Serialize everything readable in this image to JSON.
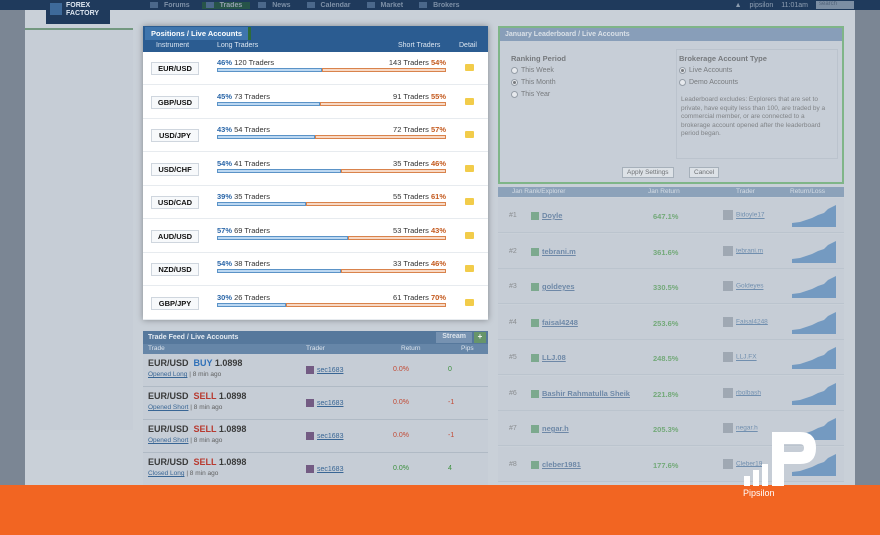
{
  "nav": {
    "items": [
      "Forums",
      "Trades",
      "News",
      "Calendar",
      "Market",
      "Brokers"
    ],
    "active": "Trades",
    "logo_line1": "FOREX",
    "logo_line2": "FACTORY",
    "username": "pipsilon",
    "time": "11:01am",
    "search_placeholder": "search"
  },
  "positions": {
    "title": "Positions / Live Accounts",
    "headers": {
      "instrument": "Instrument",
      "long": "Long Traders",
      "short": "Short Traders",
      "detail": "Detail"
    },
    "rows": [
      {
        "pair": "EUR/USD",
        "long_pct": "46%",
        "long_traders": "120 Traders",
        "short_traders": "143 Traders",
        "short_pct": "54%",
        "long": 46
      },
      {
        "pair": "GBP/USD",
        "long_pct": "45%",
        "long_traders": "73 Traders",
        "short_traders": "91 Traders",
        "short_pct": "55%",
        "long": 45
      },
      {
        "pair": "USD/JPY",
        "long_pct": "43%",
        "long_traders": "54 Traders",
        "short_traders": "72 Traders",
        "short_pct": "57%",
        "long": 43
      },
      {
        "pair": "USD/CHF",
        "long_pct": "54%",
        "long_traders": "41 Traders",
        "short_traders": "35 Traders",
        "short_pct": "46%",
        "long": 54
      },
      {
        "pair": "USD/CAD",
        "long_pct": "39%",
        "long_traders": "35 Traders",
        "short_traders": "55 Traders",
        "short_pct": "61%",
        "long": 39
      },
      {
        "pair": "AUD/USD",
        "long_pct": "57%",
        "long_traders": "69 Traders",
        "short_traders": "53 Traders",
        "short_pct": "43%",
        "long": 57
      },
      {
        "pair": "NZD/USD",
        "long_pct": "54%",
        "long_traders": "38 Traders",
        "short_traders": "33 Traders",
        "short_pct": "46%",
        "long": 54
      },
      {
        "pair": "GBP/JPY",
        "long_pct": "30%",
        "long_traders": "26 Traders",
        "short_traders": "61 Traders",
        "short_pct": "70%",
        "long": 30
      }
    ]
  },
  "feed": {
    "title": "Trade Feed / Live Accounts",
    "stream": "Stream",
    "plus": "+",
    "headers": {
      "trade": "Trade",
      "trader": "Trader",
      "return": "Return",
      "pips": "Pips"
    },
    "rows": [
      {
        "pair": "EUR/USD",
        "dir": "BUY",
        "price": "1.0898",
        "action": "Opened Long",
        "ago": "| 8 min ago",
        "trader": "sec1683",
        "ret": "0.0%",
        "pips": "0"
      },
      {
        "pair": "EUR/USD",
        "dir": "SELL",
        "price": "1.0898",
        "action": "Opened Short",
        "ago": "| 8 min ago",
        "trader": "sec1683",
        "ret": "0.0%",
        "pips": "-1"
      },
      {
        "pair": "EUR/USD",
        "dir": "SELL",
        "price": "1.0898",
        "action": "Opened Short",
        "ago": "| 8 min ago",
        "trader": "sec1683",
        "ret": "0.0%",
        "pips": "-1"
      },
      {
        "pair": "EUR/USD",
        "dir": "SELL",
        "price": "1.0898",
        "action": "Closed Long",
        "ago": "| 8 min ago",
        "trader": "sec1683",
        "ret": "0.0%",
        "pips": "4"
      }
    ]
  },
  "leaderboard": {
    "title": "January Leaderboard / Live Accounts",
    "ranking_title": "Ranking Period",
    "periods": [
      "This Week",
      "This Month",
      "This Year"
    ],
    "selected_period": "This Month",
    "acct_title": "Brokerage Account Type",
    "accounts": [
      "Live Accounts",
      "Demo Accounts"
    ],
    "selected_account": "Live Accounts",
    "description": "Leaderboard excludes: Explorers that are set to private, have equity less than 100, are traded by a commercial member, or are connected to a brokerage account opened after the leaderboard period began.",
    "apply": "Apply Settings",
    "cancel": "Cancel",
    "headers": {
      "rank": "Jan Rank/Explorer",
      "ret": "Jan Return",
      "trader": "Trader",
      "curve": "Return/Loss"
    },
    "rows": [
      {
        "rank": "#1",
        "name": "Doyle",
        "ret": "647.1%",
        "trader": "Bidoyle17"
      },
      {
        "rank": "#2",
        "name": "tebrani.m",
        "ret": "361.6%",
        "trader": "tebrani.m"
      },
      {
        "rank": "#3",
        "name": "goldeyes",
        "ret": "330.5%",
        "trader": "Goldeyes"
      },
      {
        "rank": "#4",
        "name": "faisal4248",
        "ret": "253.6%",
        "trader": "Faisal4248"
      },
      {
        "rank": "#5",
        "name": "LLJ.08",
        "ret": "248.5%",
        "trader": "LLJ.FX"
      },
      {
        "rank": "#6",
        "name": "Bashir Rahmatulla Sheik",
        "ret": "221.8%",
        "trader": "rbolbash"
      },
      {
        "rank": "#7",
        "name": "negar.h",
        "ret": "205.3%",
        "trader": "negar.h"
      },
      {
        "rank": "#8",
        "name": "cleber1981",
        "ret": "177.6%",
        "trader": "Cleber19"
      }
    ]
  },
  "brand": {
    "name": "Pipsilon",
    "color": "#f26522"
  }
}
